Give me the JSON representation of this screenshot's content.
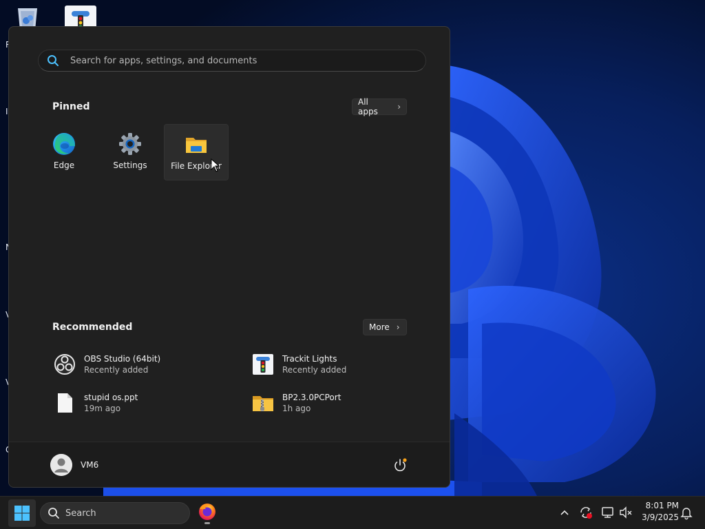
{
  "desktop": {
    "edge_letters": [
      "R",
      "I",
      "N",
      "V",
      "V",
      "C"
    ]
  },
  "start_menu": {
    "search_placeholder": "Search for apps, settings, and documents",
    "pinned": {
      "title": "Pinned",
      "all_apps_label": "All apps",
      "apps": [
        {
          "label": "Edge",
          "icon": "edge-icon"
        },
        {
          "label": "Settings",
          "icon": "gear-icon"
        },
        {
          "label": "File Explorer",
          "icon": "folder-icon"
        }
      ]
    },
    "recommended": {
      "title": "Recommended",
      "more_label": "More",
      "items": [
        {
          "name": "OBS Studio (64bit)",
          "sub": "Recently added",
          "icon": "obs-icon"
        },
        {
          "name": "Trackit Lights",
          "sub": "Recently added",
          "icon": "traffic-light-icon"
        },
        {
          "name": "stupid os.ppt",
          "sub": "19m ago",
          "icon": "document-icon"
        },
        {
          "name": "BP2.3.0PCPort",
          "sub": "1h ago",
          "icon": "zip-folder-icon"
        }
      ]
    },
    "user": {
      "name": "VM6"
    }
  },
  "taskbar": {
    "search_label": "Search",
    "clock": {
      "time": "8:01 PM",
      "date": "3/9/2025"
    }
  },
  "colors": {
    "accent_blue": "#0078d4",
    "menu_bg": "#202020",
    "taskbar_bg": "#1c1c1c",
    "notification_dot": "#f7a21b",
    "error_red": "#e81123"
  }
}
